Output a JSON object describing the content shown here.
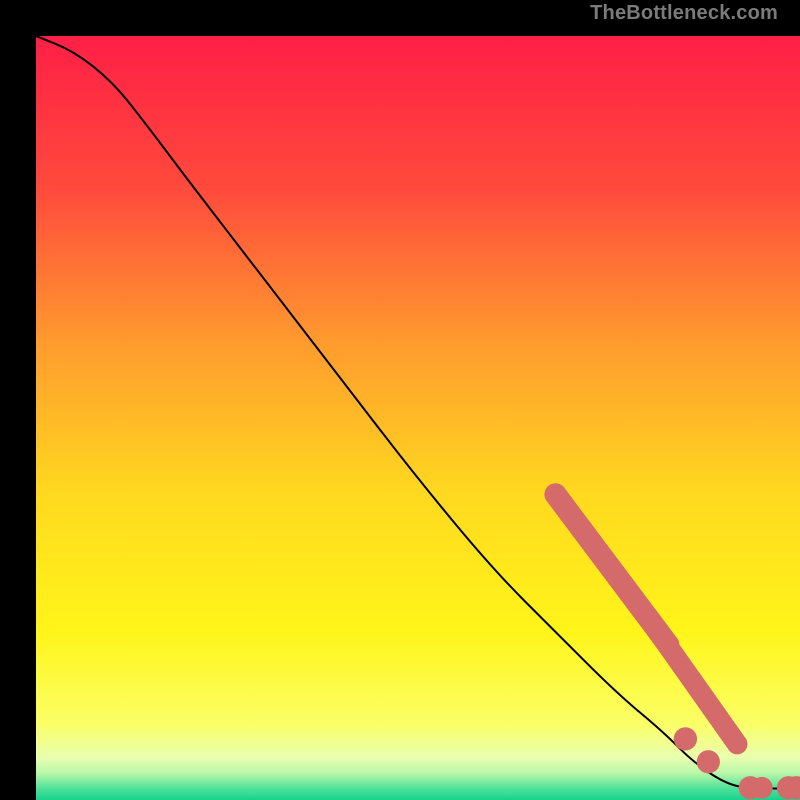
{
  "watermark": "TheBottleneck.com",
  "chart_data": {
    "type": "line",
    "title": "",
    "xlabel": "",
    "ylabel": "",
    "xlim": [
      0,
      100
    ],
    "ylim": [
      0,
      100
    ],
    "background_gradient": {
      "stops": [
        {
          "offset": 0.0,
          "color": "#ff1f46"
        },
        {
          "offset": 0.2,
          "color": "#ff4a3c"
        },
        {
          "offset": 0.4,
          "color": "#ff9a2e"
        },
        {
          "offset": 0.6,
          "color": "#ffd91f"
        },
        {
          "offset": 0.78,
          "color": "#fff51a"
        },
        {
          "offset": 0.9,
          "color": "#fbff66"
        },
        {
          "offset": 0.945,
          "color": "#e8ffb0"
        },
        {
          "offset": 0.965,
          "color": "#b8f7a8"
        },
        {
          "offset": 0.985,
          "color": "#4de19a"
        },
        {
          "offset": 1.0,
          "color": "#18d28d"
        }
      ]
    },
    "curve": [
      {
        "x": 0,
        "y": 100
      },
      {
        "x": 5,
        "y": 98
      },
      {
        "x": 10,
        "y": 94
      },
      {
        "x": 14,
        "y": 89
      },
      {
        "x": 20,
        "y": 81
      },
      {
        "x": 30,
        "y": 68
      },
      {
        "x": 40,
        "y": 55
      },
      {
        "x": 50,
        "y": 42
      },
      {
        "x": 60,
        "y": 30
      },
      {
        "x": 68,
        "y": 22
      },
      {
        "x": 76,
        "y": 14
      },
      {
        "x": 82,
        "y": 9
      },
      {
        "x": 86,
        "y": 5
      },
      {
        "x": 90,
        "y": 2.3
      },
      {
        "x": 93,
        "y": 1.5
      },
      {
        "x": 96,
        "y": 1.5
      },
      {
        "x": 100,
        "y": 1.5
      }
    ],
    "marker_groups": [
      {
        "color": "#d46a6a",
        "points_segment": {
          "x0": 68,
          "y0": 40,
          "x1": 83,
          "y1": 20,
          "thickness": 1.6
        }
      },
      {
        "color": "#d46a6a",
        "points_segment": {
          "x0": 80,
          "y0": 24,
          "x1": 92,
          "y1": 7,
          "thickness": 1.4
        }
      }
    ],
    "isolated_markers": [
      {
        "x": 85,
        "y": 8,
        "r": 1.0,
        "color": "#d46a6a"
      },
      {
        "x": 88,
        "y": 5,
        "r": 1.0,
        "color": "#d46a6a"
      },
      {
        "x": 93.5,
        "y": 1.6,
        "r": 1.0,
        "color": "#d46a6a"
      },
      {
        "x": 95,
        "y": 1.6,
        "r": 0.9,
        "color": "#d46a6a"
      },
      {
        "x": 98.5,
        "y": 1.6,
        "r": 1.0,
        "color": "#d46a6a"
      },
      {
        "x": 99.5,
        "y": 1.6,
        "r": 1.0,
        "color": "#d46a6a"
      }
    ]
  }
}
